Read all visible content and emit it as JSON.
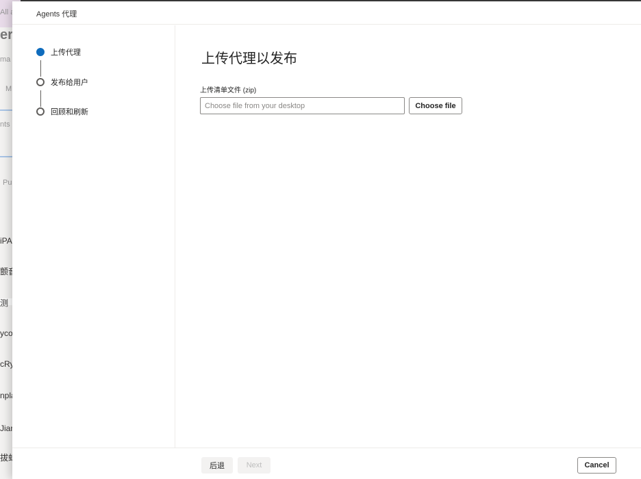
{
  "background_app": {
    "fragments": [
      "All a",
      "er",
      "ma",
      "M",
      "nts (",
      "Pub",
      "iPAQ",
      "颤音",
      "测",
      "ycor",
      "cRys",
      "npla",
      "Jian",
      "拔虹膜"
    ]
  },
  "panel": {
    "title": "Agents 代理"
  },
  "steps": [
    {
      "label": "上传代理",
      "state": "active"
    },
    {
      "label": "发布给用户",
      "state": "pending"
    },
    {
      "label": "回顾和刷新",
      "state": "pending"
    }
  ],
  "main": {
    "title": "上传代理以发布",
    "field_label": "上传清单文件 (zip)",
    "file_placeholder": "Choose file from your desktop",
    "file_value": "",
    "choose_button": "Choose file"
  },
  "footer": {
    "back_label": "后退",
    "next_label": "Next",
    "cancel_label": "Cancel"
  },
  "colors": {
    "accent": "#0f6cbd",
    "disabled_text": "#bdbdbd"
  }
}
